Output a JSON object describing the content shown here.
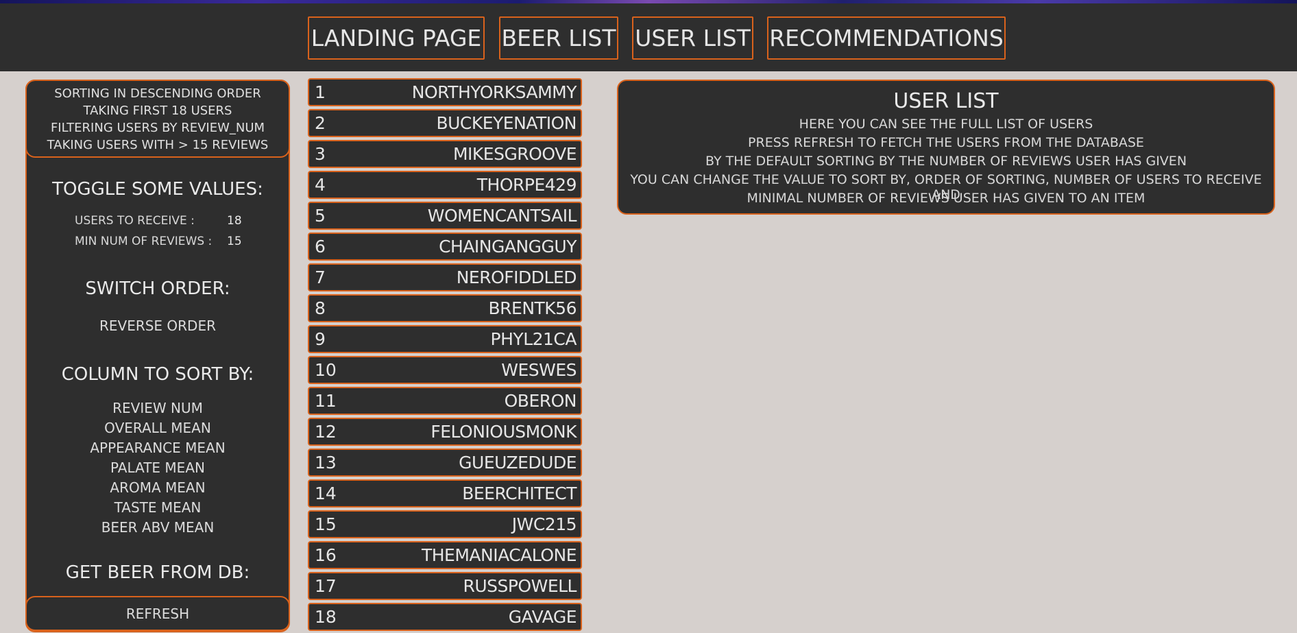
{
  "nav": {
    "items": [
      "LANDING PAGE",
      "BEER LIST",
      "USER LIST",
      "RECOMMENDATIONS"
    ]
  },
  "sidebar": {
    "info": [
      "SORTING IN DESCENDING ORDER",
      "TAKING FIRST 18 USERS",
      "FILTERING USERS BY REVIEW_NUM",
      "TAKING USERS WITH > 15 REVIEWS"
    ],
    "toggle_heading": "TOGGLE SOME VALUES:",
    "users_to_receive_label": "USERS TO RECEIVE :",
    "users_to_receive_value": "18",
    "min_reviews_label": "MIN NUM OF REVIEWS :",
    "min_reviews_value": "15",
    "order_heading": "SWITCH ORDER:",
    "reverse_label": "REVERSE ORDER",
    "sort_heading": "COLUMN TO SORT BY:",
    "sort_options": [
      "REVIEW NUM",
      "OVERALL MEAN",
      "APPEARANCE MEAN",
      "PALATE MEAN",
      "AROMA MEAN",
      "TASTE MEAN",
      "BEER ABV MEAN"
    ],
    "db_heading": "GET BEER FROM DB:",
    "refresh_label": "REFRESH"
  },
  "users": [
    {
      "rank": "1",
      "name": "NORTHYORKSAMMY"
    },
    {
      "rank": "2",
      "name": "BUCKEYENATION"
    },
    {
      "rank": "3",
      "name": "MIKESGROOVE"
    },
    {
      "rank": "4",
      "name": "THORPE429"
    },
    {
      "rank": "5",
      "name": "WOMENCANTSAIL"
    },
    {
      "rank": "6",
      "name": "CHAINGANGGUY"
    },
    {
      "rank": "7",
      "name": "NEROFIDDLED"
    },
    {
      "rank": "8",
      "name": "BRENTK56"
    },
    {
      "rank": "9",
      "name": "PHYL21CA"
    },
    {
      "rank": "10",
      "name": "WESWES"
    },
    {
      "rank": "11",
      "name": "OBERON"
    },
    {
      "rank": "12",
      "name": "FELONIOUSMONK"
    },
    {
      "rank": "13",
      "name": "GUEUZEDUDE"
    },
    {
      "rank": "14",
      "name": "BEERCHITECT"
    },
    {
      "rank": "15",
      "name": "JWC215"
    },
    {
      "rank": "16",
      "name": "THEMANIACALONE"
    },
    {
      "rank": "17",
      "name": "RUSSPOWELL"
    },
    {
      "rank": "18",
      "name": "GAVAGE"
    }
  ],
  "info_panel": {
    "title": "USER LIST",
    "lines": [
      "HERE YOU CAN SEE THE FULL LIST OF USERS",
      "PRESS REFRESH TO FETCH THE USERS FROM THE DATABASE",
      "BY THE DEFAULT SORTING BY THE NUMBER OF REVIEWS USER HAS GIVEN",
      "YOU CAN CHANGE THE VALUE TO SORT BY, ORDER OF SORTING, NUMBER OF USERS TO RECEIVE AND",
      "MINIMAL NUMBER OF REVIEWS USER HAS GIVEN TO AN ITEM"
    ]
  },
  "colors": {
    "accent": "#d9621c",
    "panel": "#2e2e2e",
    "background": "#d6d0cd"
  }
}
